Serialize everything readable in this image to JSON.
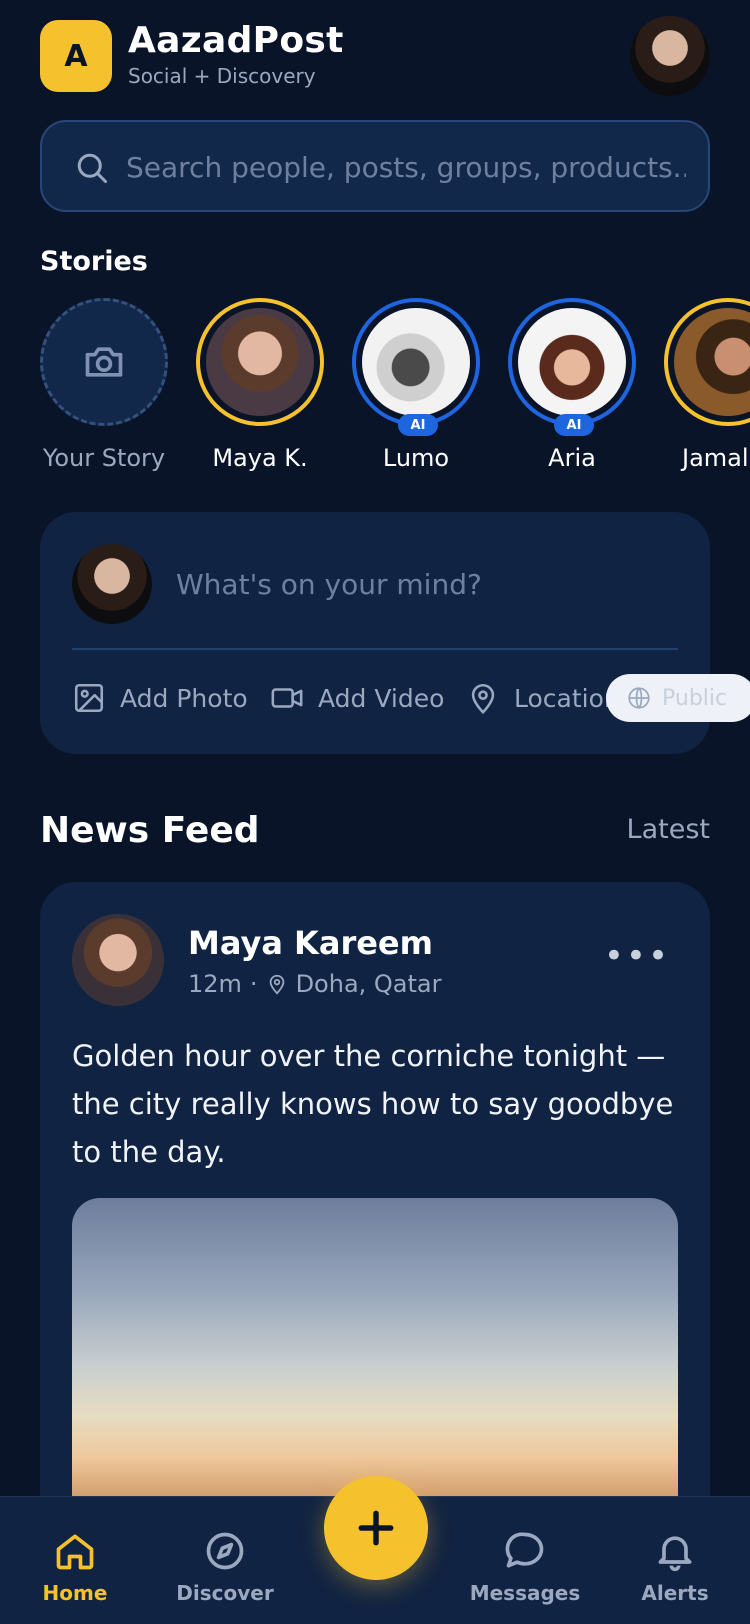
{
  "app": {
    "logo_letter": "A",
    "title": "AazadPost",
    "subtitle": "Social + Discovery"
  },
  "search": {
    "placeholder": "Search people, posts, groups, products..."
  },
  "stories": {
    "title": "Stories",
    "items": [
      {
        "name": "Your Story",
        "type": "add",
        "ring": "dashed"
      },
      {
        "name": "Maya K.",
        "ring": "gold"
      },
      {
        "name": "Lumo",
        "ring": "blue",
        "badge": "AI"
      },
      {
        "name": "Aria",
        "ring": "blue",
        "badge": "AI"
      },
      {
        "name": "Jamal",
        "ring": "gold"
      }
    ]
  },
  "composer": {
    "placeholder": "What's on your mind?",
    "actions": {
      "photo": "Add Photo",
      "video": "Add Video",
      "location": "Location",
      "privacy": "Public"
    }
  },
  "feed": {
    "title": "News Feed",
    "sort": "Latest"
  },
  "post": {
    "author": "Maya Kareem",
    "time": "12m",
    "separator": "·",
    "location": "Doha, Qatar",
    "menu": "•••",
    "text": "Golden hour over the corniche tonight — the city really knows how to say goodbye to the day."
  },
  "nav": {
    "home": "Home",
    "discover": "Discover",
    "messages": "Messages",
    "alerts": "Alerts"
  },
  "colors": {
    "background": "#0a1428",
    "card": "#112342",
    "accent": "#f5c22e",
    "ai_blue": "#1e66e0",
    "muted_text": "#9aa8c0"
  },
  "icons": {
    "search": "search-icon",
    "camera": "camera-icon",
    "photo": "image-icon",
    "video": "video-icon",
    "location": "map-pin-icon",
    "globe": "globe-icon",
    "home": "home-icon",
    "discover": "compass-icon",
    "messages": "chat-bubble-icon",
    "alerts": "bell-icon",
    "plus": "plus-icon"
  }
}
